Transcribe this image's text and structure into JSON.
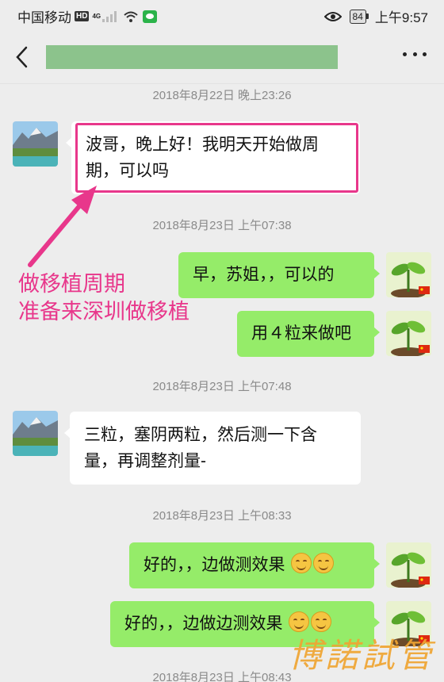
{
  "status_bar": {
    "carrier": "中国移动",
    "hd": "HD",
    "network": "4G",
    "battery": "84",
    "time": "上午9:57"
  },
  "header": {
    "back_icon": "chevron-left-icon",
    "more_icon": "more-dots-icon"
  },
  "chat": {
    "timestamps": [
      "2018年8月22日 晚上23:26",
      "2018年8月23日 上午07:38",
      "2018年8月23日 上午07:48",
      "2018年8月23日 上午08:33",
      "2018年8月23日 上午08:43"
    ],
    "messages": [
      {
        "side": "in",
        "text": "波哥，晚上好！我明天开始做周期，可以吗"
      },
      {
        "side": "out",
        "text": "早，苏姐，，可以的"
      },
      {
        "side": "out",
        "text": "用４粒来做吧"
      },
      {
        "side": "in",
        "text": "三粒，塞阴两粒，然后测一下含量，再调整剂量-"
      },
      {
        "side": "out",
        "text": "好的，，边做测效果"
      },
      {
        "side": "out",
        "text": "好的，，边做边测效果"
      }
    ],
    "emoji_name": "smiling-face-emoji"
  },
  "annotation": {
    "line1": "做移植周期",
    "line2": "准备来深圳做移植",
    "color": "#e8378b"
  },
  "watermark": {
    "text": "博諾試管",
    "color": "#f0a532"
  },
  "colors": {
    "background": "#ededed",
    "outgoing_bubble": "#95ec69",
    "incoming_bubble": "#ffffff",
    "title_mask": "#8cc38c"
  }
}
